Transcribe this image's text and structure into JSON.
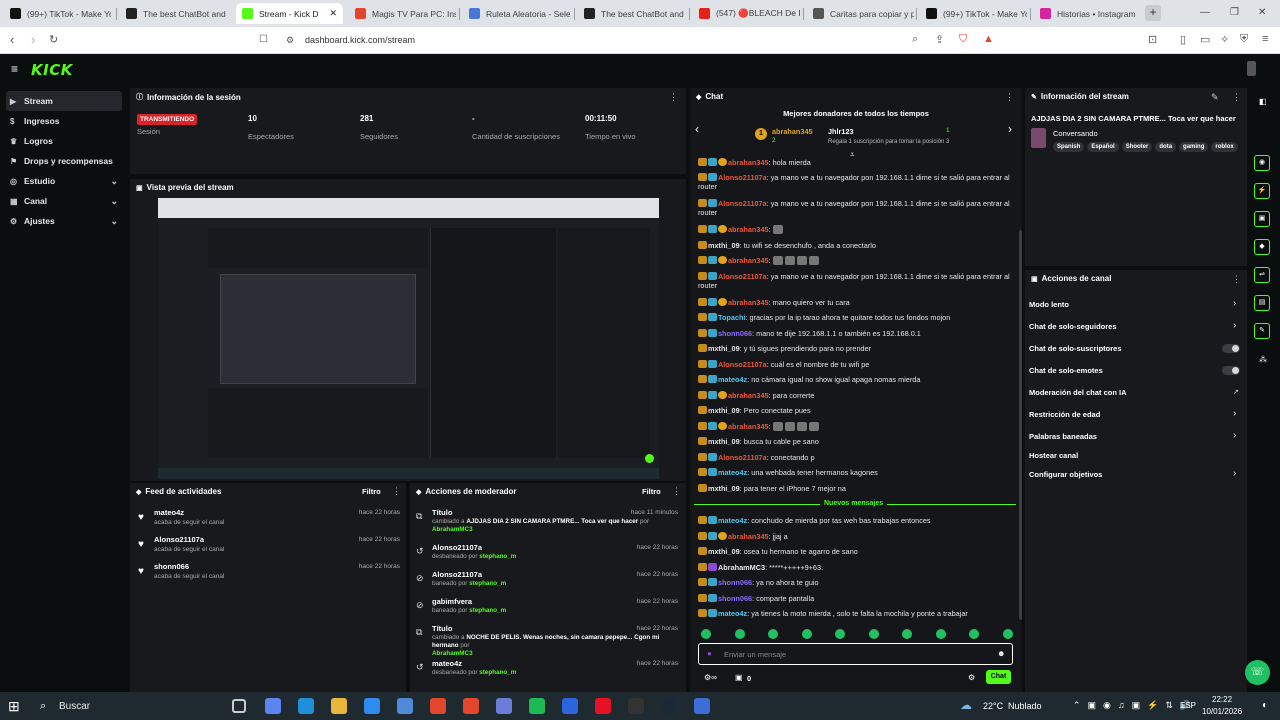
{
  "browser": {
    "tabs": [
      {
        "label": "(99+) TikTok - Make Yo",
        "color": "#111"
      },
      {
        "label": "The best ChatBot and",
        "color": "#222"
      },
      {
        "label": "Stream - Kick D",
        "color": "#53fc18"
      },
      {
        "label": "Magis TV Para PC: Inst",
        "color": "#e2472b"
      },
      {
        "label": "Ruleta Aleatoria - Sele",
        "color": "#4a76d6"
      },
      {
        "label": "The best ChatBot and",
        "color": "#222"
      },
      {
        "label": "(547) 🔴BLEACH De P",
        "color": "#e62117"
      },
      {
        "label": "Caritas para copiar y p",
        "color": "#555"
      },
      {
        "label": "(99+) TikTok - Make Yo",
        "color": "#111"
      },
      {
        "label": "Historias • Instagram",
        "color": "#d6249f"
      }
    ],
    "new_tab": "+",
    "url": "dashboard.kick.com/stream"
  },
  "kick": {
    "logo": "KICK"
  },
  "sidebar": {
    "items": [
      {
        "label": "Stream",
        "icon": "stream-icon"
      },
      {
        "label": "Ingresos",
        "icon": "money-icon"
      },
      {
        "label": "Logros",
        "icon": "trophy-icon"
      },
      {
        "label": "Drops y recompensas",
        "icon": "gift-icon"
      },
      {
        "label": "Estudio",
        "icon": "studio-icon"
      },
      {
        "label": "Canal",
        "icon": "channel-icon"
      },
      {
        "label": "Ajustes",
        "icon": "gear-icon"
      }
    ]
  },
  "session": {
    "title": "Información de la sesión",
    "badge": "TRANSMITIENDO",
    "stats": [
      {
        "value": "",
        "label": "Sesión"
      },
      {
        "value": "10",
        "label": "Espectadores"
      },
      {
        "value": "281",
        "label": "Seguidores"
      },
      {
        "value": "-",
        "label": "Cantidad de suscripciones"
      },
      {
        "value": "00:11:50",
        "label": "Tiempo en vivo"
      }
    ]
  },
  "preview": {
    "title": "Vista previa del stream"
  },
  "activity": {
    "title": "Feed de actividades",
    "filter": "Filtro",
    "items": [
      {
        "name": "mateo4z",
        "action": "acaba de seguir el canal",
        "time": "hace 22 horas"
      },
      {
        "name": "Alonso21107a",
        "action": "acaba de seguir el canal",
        "time": "hace 22 horas"
      },
      {
        "name": "shonn066",
        "action": "acaba de seguir el canal",
        "time": "hace 22 horas"
      }
    ]
  },
  "modactions": {
    "title": "Acciones de moderador",
    "filter": "Filtro",
    "items": [
      {
        "name": "Título",
        "pre": "cambiado a",
        "obj": "AJDJAS DIA 2 SIN CAMARA PTMRE... Toca ver que hacer",
        "post": "por",
        "by": "AbrahamMC3",
        "time": "hace 11 minutos"
      },
      {
        "name": "Alonso21107a",
        "pre": "desbaneado por",
        "obj": "",
        "post": "",
        "by": "stephano_m",
        "time": "hace 22 horas"
      },
      {
        "name": "Alonso21107a",
        "pre": "baneado por",
        "obj": "",
        "post": "",
        "by": "stephano_m",
        "time": "hace 22 horas"
      },
      {
        "name": "gabimfvera",
        "pre": "baneado por",
        "obj": "",
        "post": "",
        "by": "stephano_m",
        "time": "hace 22 horas"
      },
      {
        "name": "Título",
        "pre": "cambiado a",
        "obj": "NOCHE DE PELIS. Wenas noches, sin camara pepepe... Cgon mi hermano",
        "post": "por",
        "by": "AbrahamMC3",
        "time": "hace 22 horas"
      },
      {
        "name": "mateo4z",
        "pre": "desbaneado por",
        "obj": "",
        "post": "",
        "by": "stephano_m",
        "time": "hace 22 horas"
      }
    ]
  },
  "chat": {
    "title": "Chat",
    "donors_title": "Mejores donadores de todos los tiempos",
    "donor1": {
      "name": "abrahan345",
      "count": "2"
    },
    "donor2": {
      "name": "Jhlr123",
      "count": "1",
      "note": "Regala 1 suscripción para tomar la posición 3"
    },
    "new_messages": "Nuevos mensajes",
    "input_placeholder": "Enviar un mensaje",
    "send": "Chat",
    "footer_count": "0",
    "messages": [
      {
        "user": "abrahan345",
        "color": "#f0553a",
        "text": "hola mierda"
      },
      {
        "user": "Alonso21107a",
        "color": "#f0553a",
        "text": "ya mano ve a tu navegador pon 192.168.1.1 dime si te salió para entrar al router"
      },
      {
        "user": "Alonso21107a",
        "color": "#f0553a",
        "text": "ya mano ve a tu navegador pon 192.168.1.1 dime si te salió para entrar al router"
      },
      {
        "user": "abrahan345",
        "color": "#f0553a",
        "text": ""
      },
      {
        "user": "mxthi_09",
        "color": "#e6e6e6",
        "text": "tu wifi se desenchufo , anda a conectarlo"
      },
      {
        "user": "abrahan345",
        "color": "#f0553a",
        "text": ""
      },
      {
        "user": "Alonso21107a",
        "color": "#f0553a",
        "text": "ya mano ve a tu navegador pon 192.168.1.1 dime si te salió para entrar al router"
      },
      {
        "user": "abrahan345",
        "color": "#f0553a",
        "text": "mano quiero ver tu cara"
      },
      {
        "user": "Topachi",
        "color": "#53c7f0",
        "text": "gracias por la ip tarao ahora te quitare todos tus fondos mojon"
      },
      {
        "user": "shonn066",
        "color": "#8f6cff",
        "text": "mano te dije 192.168.1.1 o también es 192.168.0.1"
      },
      {
        "user": "mxthi_09",
        "color": "#e6e6e6",
        "text": "y tú sigues prendiendo para no prender"
      },
      {
        "user": "Alonso21107a",
        "color": "#f0553a",
        "text": "cuál es el nombre de tu wifi pe"
      },
      {
        "user": "mateo4z",
        "color": "#53c7f0",
        "text": "no cámara igual no show igual apaga nomas mierda"
      },
      {
        "user": "abrahan345",
        "color": "#f0553a",
        "text": "para correrte"
      },
      {
        "user": "mxthi_09",
        "color": "#e6e6e6",
        "text": "Pero conectate pues"
      },
      {
        "user": "abrahan345",
        "color": "#f0553a",
        "text": ""
      },
      {
        "user": "mxthi_09",
        "color": "#e6e6e6",
        "text": "busca tu cable pe sano"
      },
      {
        "user": "Alonso21107a",
        "color": "#f0553a",
        "text": "conectando p"
      },
      {
        "user": "mateo4z",
        "color": "#53c7f0",
        "text": "una wehbada tener hermanos kagones"
      },
      {
        "user": "mxthi_09",
        "color": "#e6e6e6",
        "text": "para tener el iPhone 7 mejor na"
      }
    ],
    "new": [
      {
        "user": "mateo4z",
        "color": "#53c7f0",
        "text": "conchudo de mierda por tas weh bas trabajas entonces"
      },
      {
        "user": "abrahan345",
        "color": "#f0553a",
        "text": "jjaj a"
      },
      {
        "user": "mxthi_09",
        "color": "#e6e6e6",
        "text": "osea tu hermano te agarro de sano"
      },
      {
        "user": "AbrahamMC3",
        "color": "#e6e6e6",
        "text": "*****+++++9+63."
      },
      {
        "user": "shonn066",
        "color": "#8f6cff",
        "text": "ya no ahora te guio"
      },
      {
        "user": "shonn066",
        "color": "#8f6cff",
        "text": "comparte pantalla"
      },
      {
        "user": "mateo4z",
        "color": "#53c7f0",
        "text": "ya tienes la moto mierda , solo te falta la mochila y ponte a trabajar"
      }
    ]
  },
  "streaminfo": {
    "title": "Información del stream",
    "stream_title": "AJDJAS DIA 2 SIN CAMARA PTMRE... Toca ver que hacer",
    "category": "Conversando",
    "tags": [
      "Spanish",
      "Español",
      "Shooter",
      "dota",
      "gaming",
      "roblox"
    ]
  },
  "channelactions": {
    "title": "Acciones de canal",
    "items": [
      {
        "label": "Modo lento",
        "control": "chevron"
      },
      {
        "label": "Chat de solo-seguidores",
        "control": "chevron"
      },
      {
        "label": "Chat de solo-suscriptores",
        "control": "toggle"
      },
      {
        "label": "Chat de solo-emotes",
        "control": "toggle"
      },
      {
        "label": "Moderación del chat con IA",
        "control": "link"
      },
      {
        "label": "Restricción de edad",
        "control": "chevron"
      },
      {
        "label": "Palabras baneadas",
        "control": "chevron"
      },
      {
        "label": "Hostear canal",
        "control": "none"
      },
      {
        "label": "Configurar objetivos",
        "control": "chevron"
      }
    ]
  },
  "taskbar": {
    "search": "Buscar",
    "weather_temp": "22°C",
    "weather_text": "Nublado",
    "lang": "ESP",
    "time": "22:22",
    "date": "10/01/2026"
  },
  "colors": {
    "accent": "#53fc18",
    "live": "#d5242b"
  }
}
